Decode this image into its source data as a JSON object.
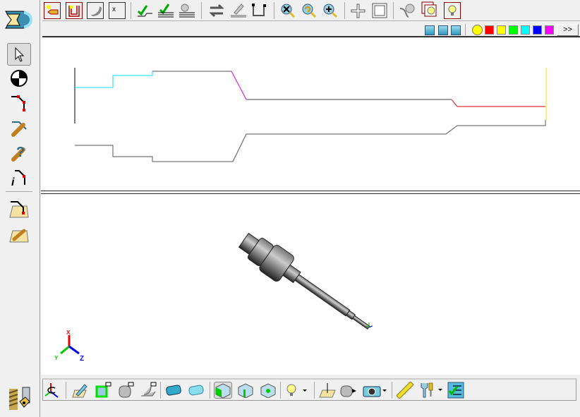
{
  "toolbar": {
    "more_label": ">>"
  },
  "colors": {
    "swatches": [
      "#ffff00",
      "#ff0000",
      "#ffff00",
      "#00ff00",
      "#00ffff",
      "#0000ff",
      "#ff00ff"
    ]
  },
  "axis_triad": {
    "x": "X",
    "y": "Y",
    "z": "Z"
  }
}
